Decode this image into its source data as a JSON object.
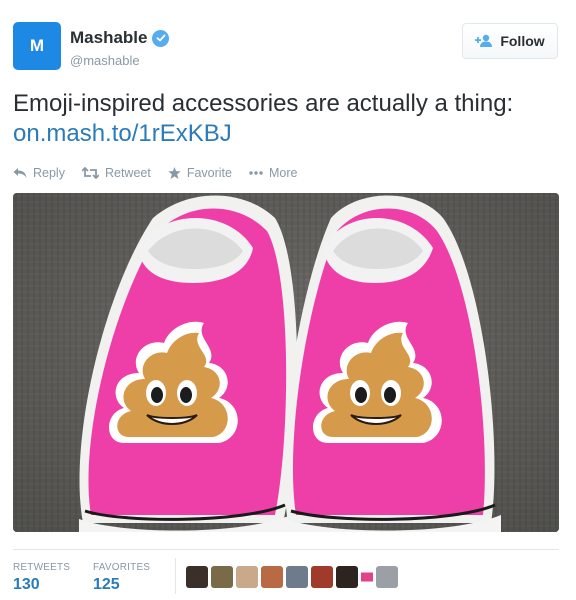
{
  "user": {
    "display_name": "Mashable",
    "handle": "@mashable",
    "avatar_letter": "M",
    "verified": true
  },
  "follow_button": {
    "label": "Follow"
  },
  "tweet": {
    "text": "Emoji-inspired accessories are actually a thing:",
    "link": "on.mash.to/1rExKBJ"
  },
  "actions": [
    {
      "label": "Reply",
      "icon": "reply-icon"
    },
    {
      "label": "Retweet",
      "icon": "retweet-icon"
    },
    {
      "label": "Favorite",
      "icon": "star-icon"
    },
    {
      "label": "More",
      "icon": "more-icon"
    }
  ],
  "media": {
    "icon": "photo-pink-poop-emoji-shoes"
  },
  "stats": {
    "retweets_label": "RETWEETS",
    "retweets_count": "130",
    "favorites_label": "FAVORITES",
    "favorites_count": "125"
  },
  "favoriters": [
    {
      "icon": "avatar-1",
      "color": "#3b2f2a"
    },
    {
      "icon": "avatar-2",
      "color": "#7a6b48"
    },
    {
      "icon": "avatar-3",
      "color": "#c9a98a"
    },
    {
      "icon": "avatar-4",
      "color": "#b86a45"
    },
    {
      "icon": "avatar-5",
      "color": "#6d7b8c"
    },
    {
      "icon": "avatar-6",
      "color": "#a03a2a"
    },
    {
      "icon": "avatar-7",
      "color": "#2d2420"
    },
    {
      "icon": "avatar-8",
      "color": "#ffffff"
    },
    {
      "icon": "avatar-9",
      "color": "#9aa0a6"
    }
  ],
  "colors": {
    "link": "#2b7bb9",
    "muted": "#8899a6",
    "verified": "#55acee",
    "avatar_bg": "#1e88e5",
    "shoe_pink": "#ee3fa8",
    "emoji_brown": "#d59a4a"
  }
}
